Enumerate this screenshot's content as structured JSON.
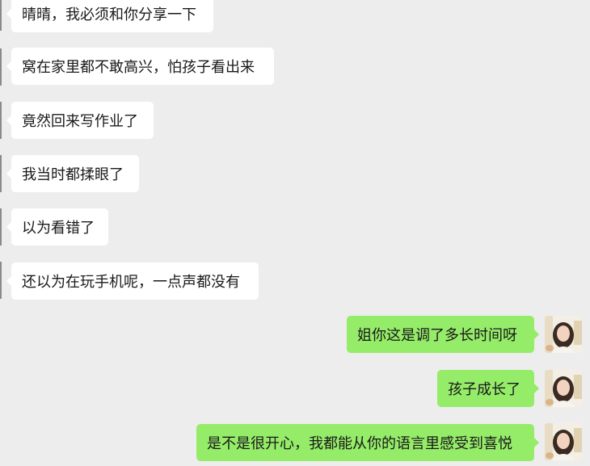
{
  "incoming": [
    {
      "text": "晴晴，我必须和你分享一下"
    },
    {
      "text": "窝在家里都不敢高兴，怕孩子看出来"
    },
    {
      "text": "竟然回来写作业了"
    },
    {
      "text": "我当时都揉眼了"
    },
    {
      "text": "以为看错了"
    },
    {
      "text": "还以为在玩手机呢，一点声都没有"
    }
  ],
  "outgoing": [
    {
      "text": "姐你这是调了多长时间呀"
    },
    {
      "text": "孩子成长了"
    },
    {
      "text": "是不是很开心，我都能从你的语言里感受到喜悦"
    }
  ],
  "colors": {
    "background": "#ededed",
    "incoming_bubble": "#ffffff",
    "outgoing_bubble": "#95ec69"
  }
}
